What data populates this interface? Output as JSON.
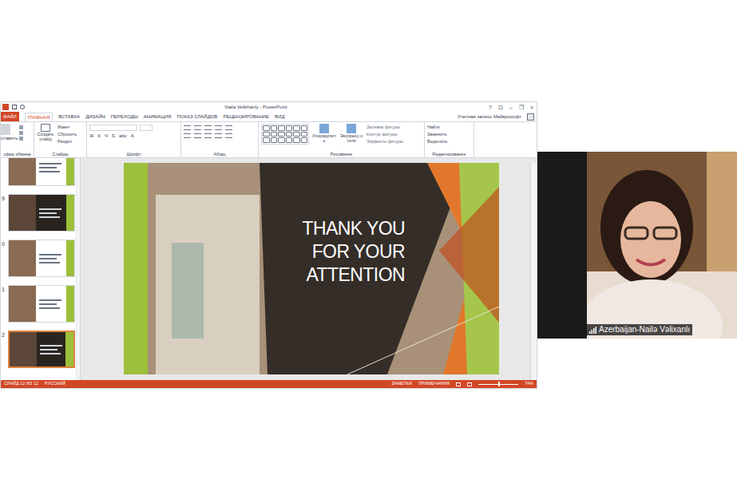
{
  "window": {
    "title": "Naila Velikhanly - PowerPoint",
    "controls": [
      "?",
      "⊡",
      "–",
      "❐",
      "×"
    ]
  },
  "ribbon_tabs": [
    {
      "label": "ФАЙЛ",
      "selected": false,
      "kind": "file"
    },
    {
      "label": "ГЛАВНАЯ",
      "selected": true,
      "kind": "tab"
    },
    {
      "label": "ВСТАВКА",
      "selected": false,
      "kind": "tab"
    },
    {
      "label": "ДИЗАЙН",
      "selected": false,
      "kind": "tab"
    },
    {
      "label": "ПЕРЕХОДЫ",
      "selected": false,
      "kind": "tab"
    },
    {
      "label": "АНИМАЦИЯ",
      "selected": false,
      "kind": "tab"
    },
    {
      "label": "ПОКАЗ СЛАЙДОВ",
      "selected": false,
      "kind": "tab"
    },
    {
      "label": "РЕЦЕНЗИРОВАНИЕ",
      "selected": false,
      "kind": "tab"
    },
    {
      "label": "ВИД",
      "selected": false,
      "kind": "tab"
    }
  ],
  "account": "Учетная запись Майкрософт",
  "ribbon_groups": [
    {
      "label": "уфер обмена",
      "buttons": [
        "ставить"
      ]
    },
    {
      "label": "Слайды",
      "buttons": [
        "Создать слайд",
        "Макет",
        "Сбросить",
        "Раздел"
      ]
    },
    {
      "label": "Шрифт",
      "buttons": [
        "Ж",
        "К",
        "Ч",
        "S",
        "abc",
        "A"
      ]
    },
    {
      "label": "Абзац",
      "buttons": []
    },
    {
      "label": "Рисование",
      "buttons": [
        "Упорядочить",
        "Экспресс-стили",
        "Заливка фигуры",
        "Контур фигуры",
        "Эффекты фигуры"
      ]
    },
    {
      "label": "Редактирование",
      "buttons": [
        "Найти",
        "Заменить",
        "Выделить"
      ]
    }
  ],
  "thumbnails": [
    {
      "number": "",
      "selected": false,
      "kind": "light"
    },
    {
      "number": "9",
      "selected": false,
      "kind": "dark"
    },
    {
      "number": "0",
      "selected": false,
      "kind": "light"
    },
    {
      "number": "1",
      "selected": false,
      "kind": "light"
    },
    {
      "number": "2",
      "selected": true,
      "kind": "dark"
    }
  ],
  "slide": {
    "lines": [
      "THANK YOU",
      "FOR YOUR",
      "ATTENTION"
    ]
  },
  "status_bar": {
    "slide": "СЛАЙД 12 ИЗ 12",
    "language": "РУССКИЙ",
    "notes": "ЗАМЕТКИ",
    "comments": "ПРИМЕЧАНИЯ",
    "zoom": "74%",
    "zoom_level": 0.5
  },
  "participant": {
    "name": "Azerbaijan-Nailə Vəlixanlı"
  }
}
